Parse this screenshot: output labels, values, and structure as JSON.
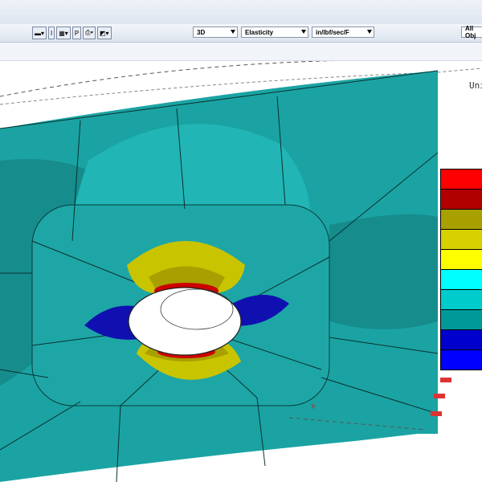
{
  "toolbar": {
    "mode_select": "3D",
    "property_select": "Elasticity",
    "units_select": "in/lbf/sec/F",
    "filter_select": "All Obj"
  },
  "viewport": {
    "units_label": "Uni"
  },
  "legend": {
    "colors": [
      "#ff0000",
      "#b00000",
      "#a8a000",
      "#d8d000",
      "#ffff00",
      "#00ffff",
      "#00cccc",
      "#009999",
      "#0000cc",
      "#0000ff"
    ]
  }
}
